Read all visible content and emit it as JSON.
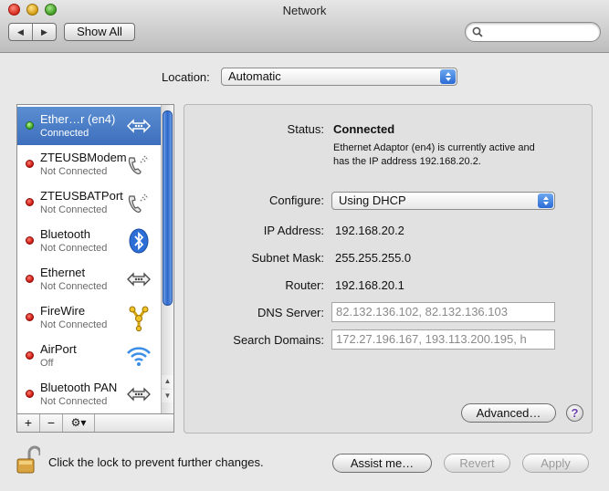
{
  "window": {
    "title": "Network"
  },
  "toolbar": {
    "show_all_label": "Show All",
    "search_placeholder": ""
  },
  "location": {
    "label": "Location:",
    "value": "Automatic"
  },
  "services": [
    {
      "name": "Ether…r (en4)",
      "status": "Connected",
      "indicator": "green",
      "icon": "ethernet-icon",
      "selected": true
    },
    {
      "name": "ZTEUSBModem",
      "status": "Not Connected",
      "indicator": "red",
      "icon": "phone-modem-icon",
      "selected": false
    },
    {
      "name": "ZTEUSBATPort",
      "status": "Not Connected",
      "indicator": "red",
      "icon": "phone-modem-icon",
      "selected": false
    },
    {
      "name": "Bluetooth",
      "status": "Not Connected",
      "indicator": "red",
      "icon": "bluetooth-icon",
      "selected": false
    },
    {
      "name": "Ethernet",
      "status": "Not Connected",
      "indicator": "red",
      "icon": "ethernet-icon",
      "selected": false
    },
    {
      "name": "FireWire",
      "status": "Not Connected",
      "indicator": "red",
      "icon": "firewire-icon",
      "selected": false
    },
    {
      "name": "AirPort",
      "status": "Off",
      "indicator": "red",
      "icon": "wifi-icon",
      "selected": false
    },
    {
      "name": "Bluetooth PAN",
      "status": "Not Connected",
      "indicator": "red",
      "icon": "ethernet-icon",
      "selected": false
    }
  ],
  "list_buttons": {
    "add": "+",
    "remove": "−",
    "action": "⚙▾"
  },
  "detail": {
    "status_label": "Status:",
    "status_value": "Connected",
    "status_description": "Ethernet Adaptor (en4) is currently active and has the IP address 192.168.20.2.",
    "configure_label": "Configure:",
    "configure_value": "Using DHCP",
    "ip_label": "IP Address:",
    "ip_value": "192.168.20.2",
    "subnet_label": "Subnet Mask:",
    "subnet_value": "255.255.255.0",
    "router_label": "Router:",
    "router_value": "192.168.20.1",
    "dns_label": "DNS Server:",
    "dns_value": "82.132.136.102, 82.132.136.103",
    "search_domains_label": "Search Domains:",
    "search_domains_value": "172.27.196.167, 193.113.200.195, h",
    "advanced_label": "Advanced…",
    "help_label": "?"
  },
  "footer": {
    "lock_text": "Click the lock to prevent further changes.",
    "assist_label": "Assist me…",
    "revert_label": "Revert",
    "apply_label": "Apply"
  }
}
